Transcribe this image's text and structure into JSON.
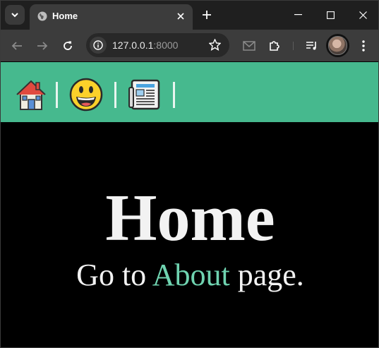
{
  "browser": {
    "tab": {
      "title": "Home",
      "favicon": "globe-icon"
    },
    "address": {
      "host": "127.0.0.1",
      "port": ":8000"
    },
    "icons": [
      "back-icon",
      "forward-icon",
      "reload-icon",
      "site-info-icon",
      "star-icon",
      "mail-icon",
      "puzzle-icon",
      "media-queue-icon",
      "menu-icon"
    ]
  },
  "navbar": {
    "items": [
      {
        "icon": "house-icon",
        "label": "home"
      },
      {
        "icon": "smiley-icon",
        "label": "about"
      },
      {
        "icon": "newspaper-icon",
        "label": "news"
      }
    ],
    "separator": "|",
    "background": "#46b98e"
  },
  "page": {
    "heading": "Home",
    "subline_prefix": "Go to ",
    "link_text": "About",
    "subline_suffix": " page.",
    "link_color": "#6fd3b0"
  }
}
